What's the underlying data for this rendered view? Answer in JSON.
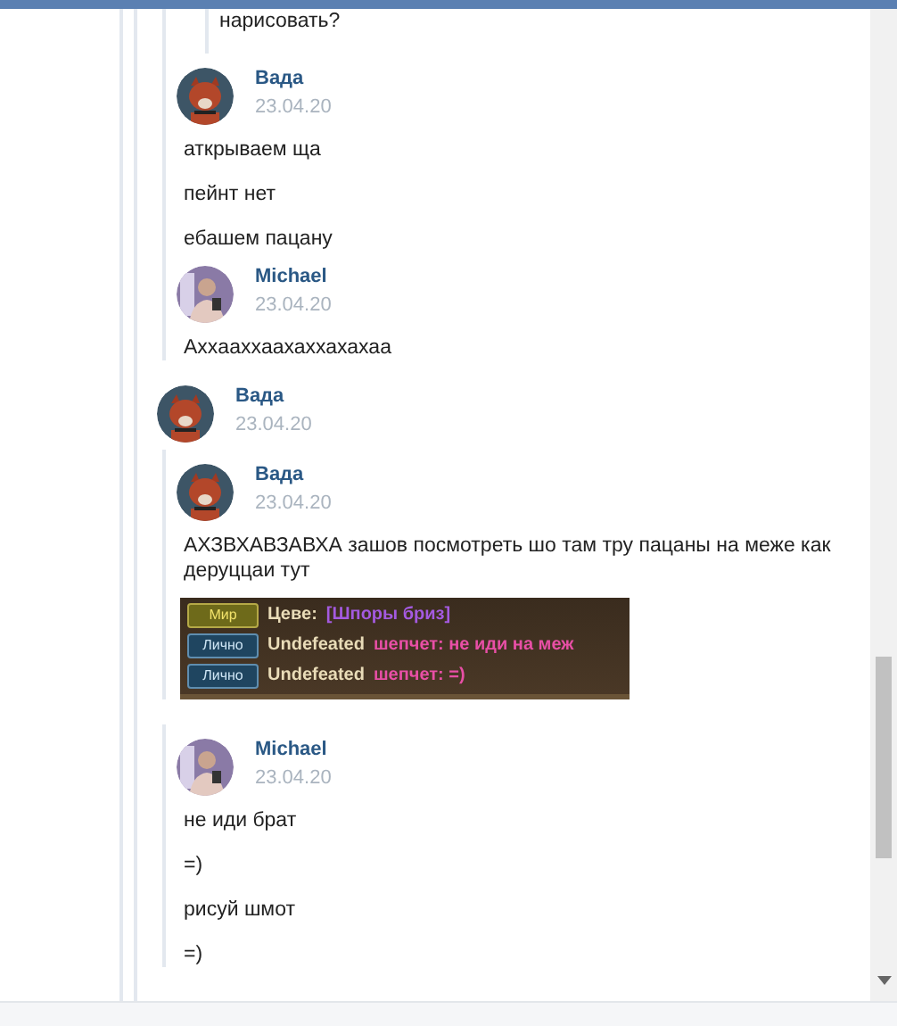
{
  "sections": [
    {
      "kind": "replies",
      "children": [
        {
          "kind": "quote",
          "text": "нарисовать?"
        },
        {
          "kind": "message",
          "author": "Вада",
          "avatar": {
            "kind": "fox"
          },
          "date": "23.04.20",
          "lines": [
            "аткрываем ща",
            "пейнт нет",
            "ебашем пацану"
          ]
        },
        {
          "kind": "message",
          "author": "Michael",
          "avatar": {
            "kind": "person"
          },
          "date": "23.04.20",
          "lines": [
            "Ахxаахxаахаххахахаа"
          ]
        }
      ]
    },
    {
      "kind": "message",
      "author": "Вада",
      "avatar": {
        "kind": "fox"
      },
      "date": "23.04.20",
      "children": [
        {
          "kind": "message",
          "author": "Вада",
          "avatar": {
            "kind": "fox"
          },
          "date": "23.04.20",
          "lines": [
            "АХЗВХАВЗАВХА зашов посмотреть шо там тру пацаны на меже как деруццаи тут"
          ],
          "attachment": {
            "chat": [
              {
                "tag": {
                  "kind": "world",
                  "text": "Мир"
                },
                "name": "Цеве:",
                "message": {
                  "kind": "world",
                  "text": "[Шпоры бриз]"
                }
              },
              {
                "tag": {
                  "kind": "private",
                  "text": "Лично"
                },
                "name": "Undefeated",
                "message": {
                  "kind": "whisper",
                  "text": "шепчет: не иди на меж"
                }
              },
              {
                "tag": {
                  "kind": "private",
                  "text": "Лично"
                },
                "name": "Undefeated",
                "message": {
                  "kind": "whisper",
                  "text": "шепчет: =)"
                }
              }
            ]
          }
        }
      ]
    },
    {
      "kind": "replies",
      "children": [
        {
          "kind": "message",
          "author": "Michael",
          "avatar": {
            "kind": "person"
          },
          "date": "23.04.20",
          "lines": [
            "не иди брат",
            "=)",
            "рисуй шмот",
            "=)"
          ]
        }
      ]
    }
  ]
}
